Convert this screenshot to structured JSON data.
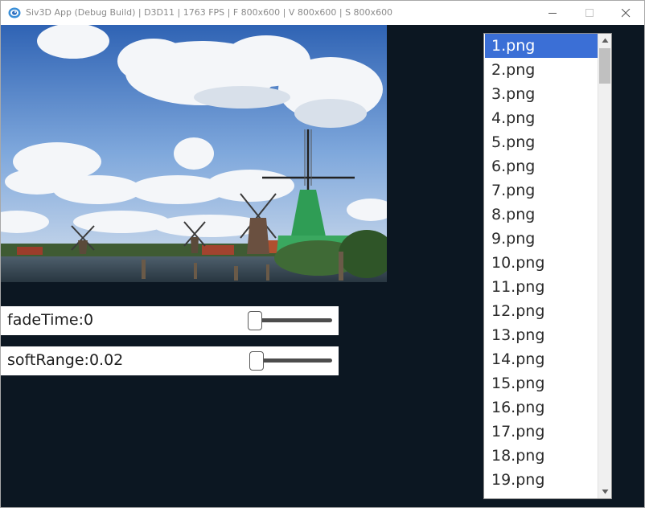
{
  "window": {
    "title": "Siv3D App (Debug Build) | D3D11 | 1763 FPS | F 800x600 | V 800x600 | S 800x600",
    "icon": "siv3d-logo-icon"
  },
  "controls": {
    "minimize": "minimize-icon",
    "maximize": "maximize-icon",
    "close": "close-icon"
  },
  "image": {
    "subject": "windmills-landscape-photo"
  },
  "sliders": [
    {
      "label": "fadeTime:0",
      "value": 0.0
    },
    {
      "label": "softRange:0.02",
      "value": 0.02
    }
  ],
  "listbox": {
    "selected_index": 0,
    "items": [
      "1.png",
      "2.png",
      "3.png",
      "4.png",
      "5.png",
      "6.png",
      "7.png",
      "8.png",
      "9.png",
      "10.png",
      "11.png",
      "12.png",
      "13.png",
      "14.png",
      "15.png",
      "16.png",
      "17.png",
      "18.png",
      "19.png"
    ]
  },
  "colors": {
    "background": "#0c1722",
    "selection": "#3b6fd6",
    "panel": "#ffffff"
  }
}
